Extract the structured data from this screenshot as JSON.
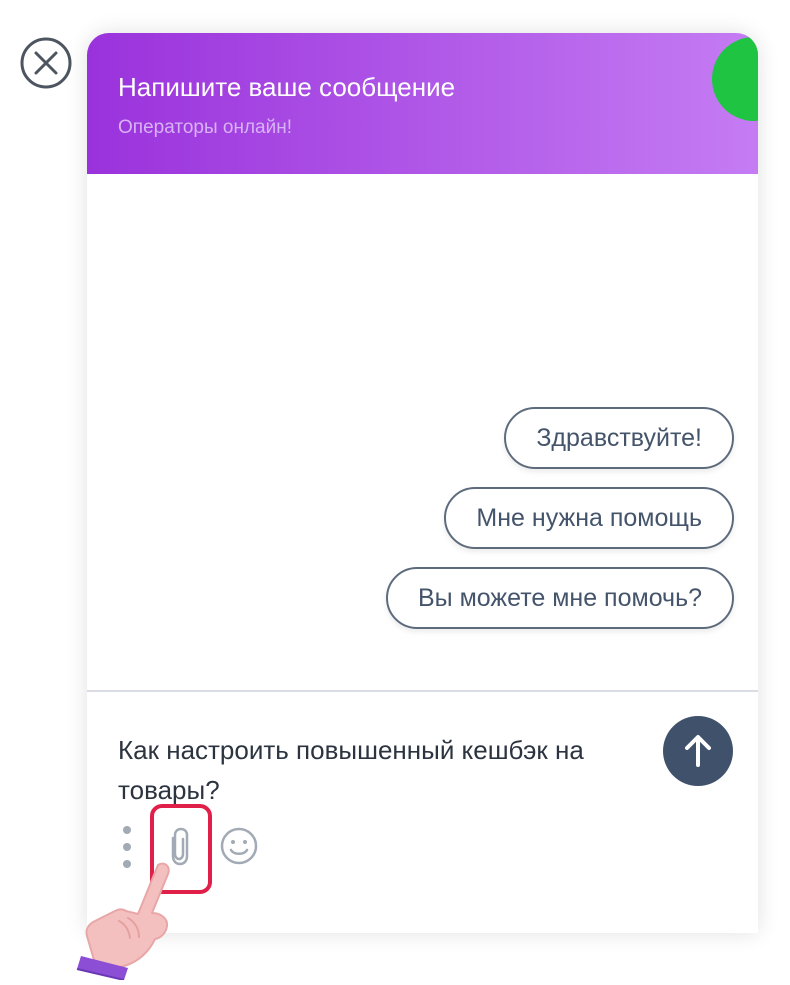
{
  "header": {
    "title": "Напишите ваше сообщение",
    "subtitle": "Операторы онлайн!"
  },
  "quick_replies": [
    "Здравствуйте!",
    "Мне нужна помощь",
    "Вы можете мне помочь?"
  ],
  "composer": {
    "message": "Как настроить повышенный кешбэк на товары?"
  },
  "icons": {
    "close": "close-icon",
    "send": "arrow-up-icon",
    "menu": "menu-dots-icon",
    "attach": "paperclip-icon",
    "emoji": "smile-icon",
    "pointer": "pointing-hand-icon"
  },
  "colors": {
    "header_start": "#9a32dc",
    "header_end": "#c57cf3",
    "online_status": "#1fc442",
    "send_button": "#40516b",
    "highlight": "#e02049"
  }
}
